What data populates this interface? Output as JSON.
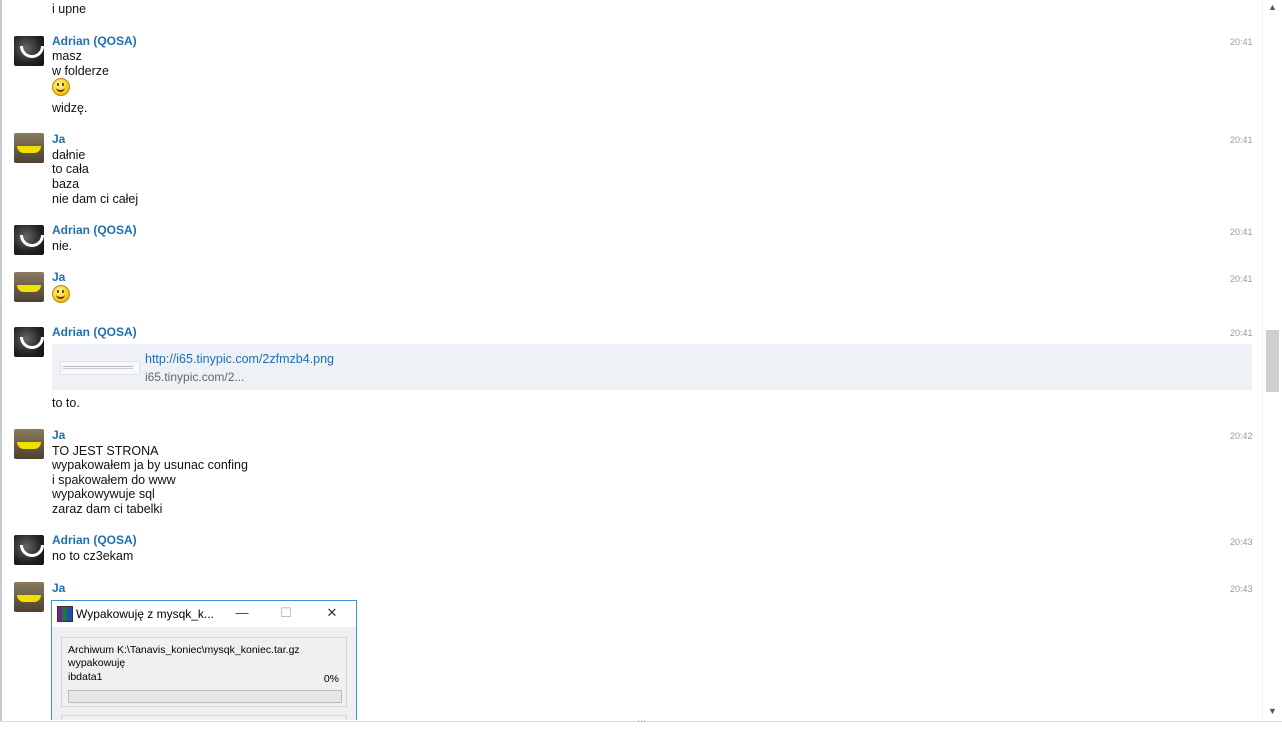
{
  "messages": {
    "top_line": "i upne",
    "adrian_name": "Adrian (QOSA)",
    "ja_name": "Ja",
    "m1": {
      "time": "20:41",
      "lines": [
        "masz",
        "w folderze"
      ],
      "after_emoji": "widzę."
    },
    "m2": {
      "time": "20:41",
      "lines": [
        "dałnie",
        "to cała",
        "baza",
        "nie dam ci całej"
      ]
    },
    "m3": {
      "time": "20:41",
      "lines": [
        "nie."
      ]
    },
    "m4": {
      "time": "20:41"
    },
    "m5": {
      "time": "20:41",
      "link_url": "http://i65.tinypic.com/2zfmzb4.png",
      "link_domain": "i65.tinypic.com/2...",
      "after": "to to."
    },
    "m6": {
      "time": "20:42",
      "lines": [
        "TO JEST STRONA",
        "wypakowałem ja by usunac confing",
        "i spakowałem do www",
        "wypakowywuje sql",
        "zaraz dam ci tabelki"
      ]
    },
    "m7": {
      "time": "20:43",
      "lines": [
        "no to cz3ekam"
      ]
    },
    "m8": {
      "time": "20:43"
    }
  },
  "winrar": {
    "title": "Wypakowuję z mysqk_k...",
    "minimize": "—",
    "maximize": "☐",
    "close": "✕",
    "archive_line": "Archiwum K:\\Tanavis_koniec\\mysqk_koniec.tar.gz",
    "status": "wypakowuję",
    "file": "ibdata1",
    "percent": "0%",
    "progress_fraction": 0
  },
  "scroll": {
    "up": "▲",
    "down": "▼"
  }
}
